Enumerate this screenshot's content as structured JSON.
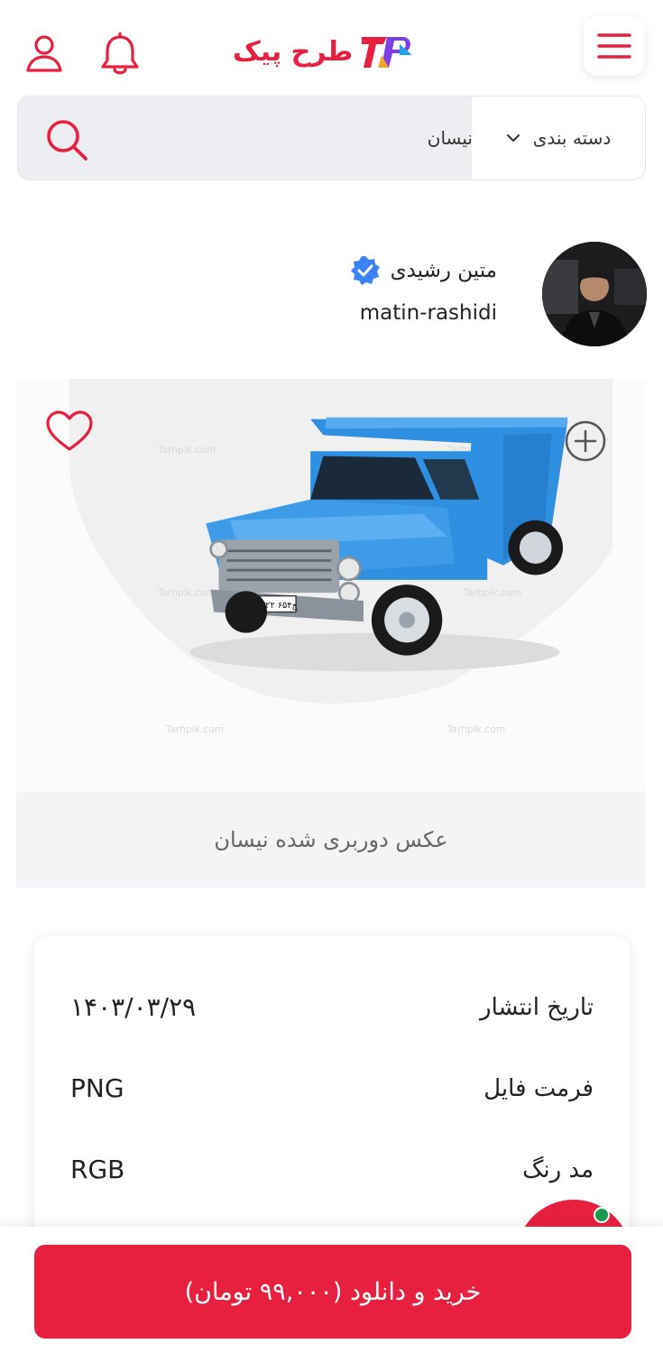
{
  "header": {
    "logo_text": "طرح پیک",
    "icons": [
      "user-icon",
      "bell-icon",
      "menu-icon"
    ]
  },
  "search": {
    "category_label": "دسته بندی",
    "query": "نیسان"
  },
  "author": {
    "name": "متین رشیدی",
    "username": "matin-rashidi",
    "verified": true
  },
  "product": {
    "caption": "عکس دوربری شده نیسان",
    "watermark": "Tarhpik.com",
    "plate": "۵۳ج۶۵۴ ۲۲"
  },
  "info": {
    "rows": [
      {
        "label": "تاریخ انتشار",
        "value": "۱۴۰۳/۰۳/۲۹"
      },
      {
        "label": "فرمت فایل",
        "value": "PNG"
      },
      {
        "label": "مد رنگ",
        "value": "RGB"
      }
    ]
  },
  "cta": {
    "buy_label": "خرید و دانلود (۹۹,۰۰۰ تومان)"
  },
  "colors": {
    "brand": "#e8203f",
    "truck": "#2f8fe0",
    "verified": "#3b82f6"
  }
}
